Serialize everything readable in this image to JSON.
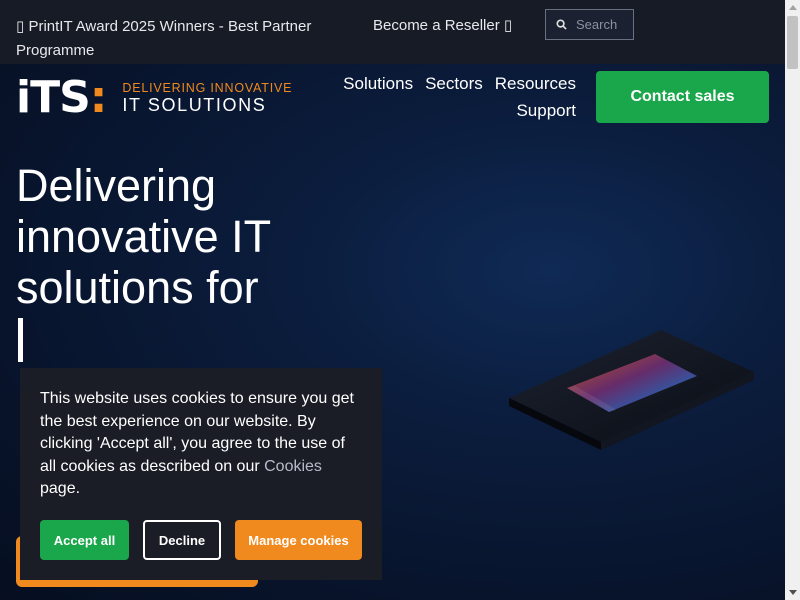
{
  "topbar": {
    "announcement": "PrintIT Award 2025 Winners - Best Partner Programme",
    "announcement_icon": "award-icon",
    "reseller_label": "Become a Reseller",
    "reseller_icon": "external-link-icon",
    "search_placeholder": "Search"
  },
  "logo": {
    "mark": "iTS",
    "colon": ":",
    "line1": "DELIVERING INNOVATIVE",
    "line2": "IT SOLUTIONS"
  },
  "nav": {
    "items": [
      "Solutions",
      "Sectors",
      "Resources",
      "Support"
    ]
  },
  "header": {
    "contact_label": "Contact sales"
  },
  "hero": {
    "title": "Delivering innovative IT solutions for"
  },
  "cookie": {
    "text": "This website uses cookies to ensure you get the best experience on our website. By clicking 'Accept all', you agree to the use of all cookies as described on our ",
    "link": "Cookies",
    "text_end": " page.",
    "accept_label": "Accept all",
    "decline_label": "Decline",
    "manage_label": "Manage cookies"
  },
  "colors": {
    "brand_orange": "#f08a1f",
    "brand_green": "#1aa64a",
    "topbar_bg": "#161b26",
    "hero_bg": "#0b1c3c"
  }
}
